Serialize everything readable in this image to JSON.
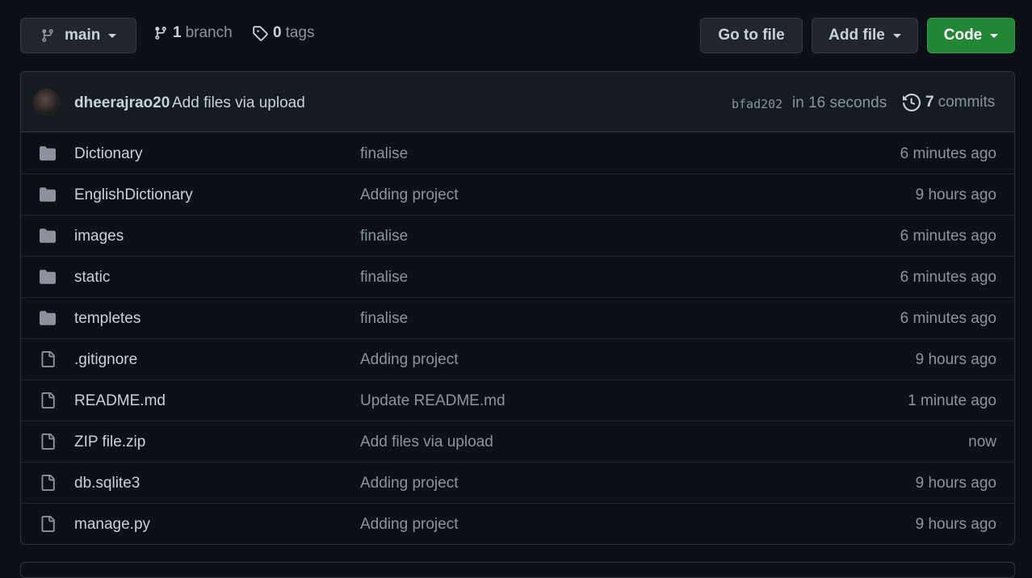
{
  "toolbar": {
    "branch_button": {
      "label": "main",
      "icon": "git-branch-icon"
    },
    "branches": {
      "count": "1",
      "label": "branch",
      "icon": "git-branch-icon"
    },
    "tags": {
      "count": "0",
      "label": "tags",
      "icon": "tag-icon"
    },
    "go_to_file_label": "Go to file",
    "add_file_label": "Add file",
    "code_label": "Code"
  },
  "latest_commit": {
    "author": "dheerajrao20",
    "message": "Add files via upload",
    "sha": "bfad202",
    "time": "in 16 seconds",
    "commits_count": "7",
    "commits_label": "commits",
    "commits_icon": "history-icon"
  },
  "files": [
    {
      "type": "folder",
      "name": "Dictionary",
      "message": "finalise",
      "age": "6 minutes ago"
    },
    {
      "type": "folder",
      "name": "EnglishDictionary",
      "message": "Adding project",
      "age": "9 hours ago"
    },
    {
      "type": "folder",
      "name": "images",
      "message": "finalise",
      "age": "6 minutes ago"
    },
    {
      "type": "folder",
      "name": "static",
      "message": "finalise",
      "age": "6 minutes ago"
    },
    {
      "type": "folder",
      "name": "templetes",
      "message": "finalise",
      "age": "6 minutes ago"
    },
    {
      "type": "file",
      "name": ".gitignore",
      "message": "Adding project",
      "age": "9 hours ago"
    },
    {
      "type": "file",
      "name": "README.md",
      "message": "Update README.md",
      "age": "1 minute ago"
    },
    {
      "type": "file",
      "name": "ZIP file.zip",
      "message": "Add files via upload",
      "age": "now"
    },
    {
      "type": "file",
      "name": "db.sqlite3",
      "message": "Adding project",
      "age": "9 hours ago"
    },
    {
      "type": "file",
      "name": "manage.py",
      "message": "Adding project",
      "age": "9 hours ago"
    }
  ],
  "colors": {
    "background": "#0d1117",
    "header_background": "#161b22",
    "border": "#30363d",
    "code_button": "#238636",
    "text_primary": "#c9d1d9",
    "text_muted": "#8b949e",
    "icon": "#8b949e"
  }
}
